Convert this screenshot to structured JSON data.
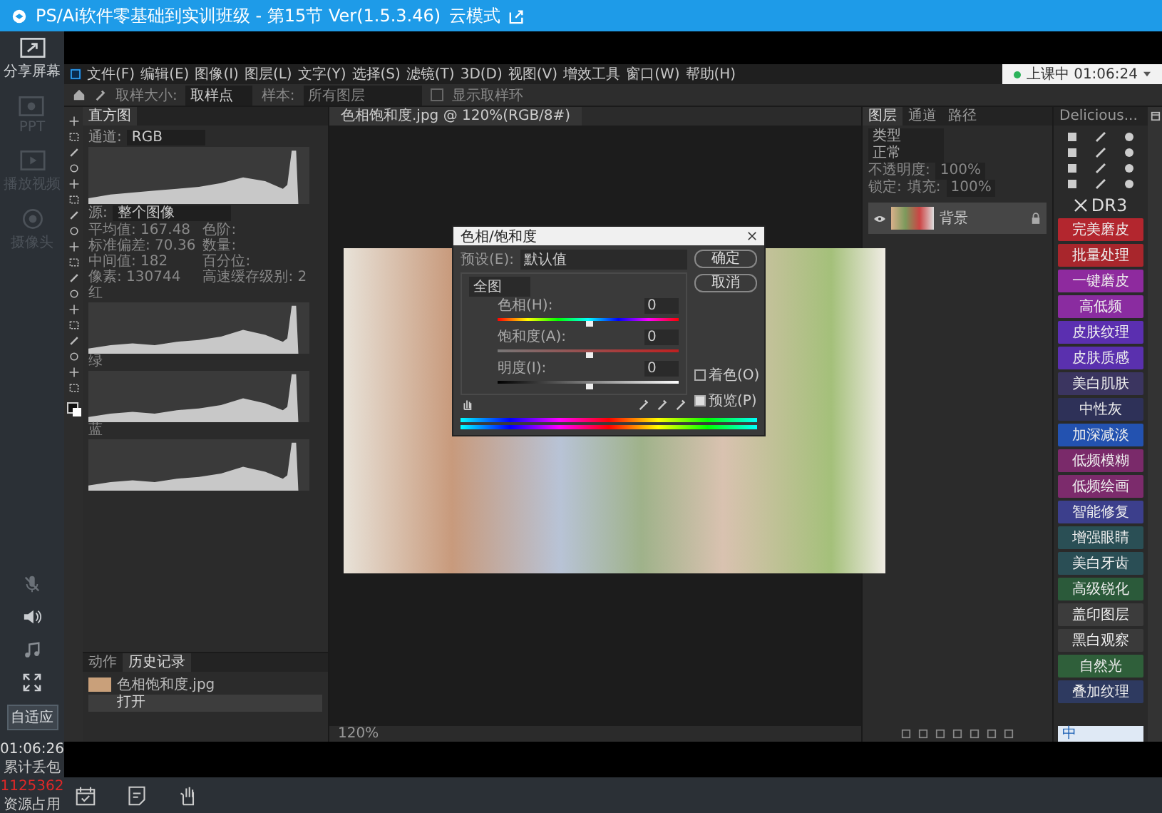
{
  "title_bar": {
    "title": "PS/Ai软件零基础到实训班级 - 第15节 Ver(1.5.3.46)",
    "mode": "云模式"
  },
  "sidebar": {
    "items": [
      {
        "label": "分享屏幕",
        "kind": "share",
        "disabled": false
      },
      {
        "label": "PPT",
        "kind": "ppt",
        "disabled": true
      },
      {
        "label": "播放视频",
        "kind": "video",
        "disabled": true
      },
      {
        "label": "摄像头",
        "kind": "camera",
        "disabled": true
      }
    ],
    "mic_muted": true,
    "fit_button": "自适应",
    "timer": "01:06:26",
    "loss_label": "累计丢包",
    "loss_value": "1125362",
    "resource_label": "资源占用"
  },
  "live_status": {
    "label": "上课中 01:06:24",
    "live": true
  },
  "photoshop": {
    "menu": [
      "文件(F)",
      "编辑(E)",
      "图像(I)",
      "图层(L)",
      "文字(Y)",
      "选择(S)",
      "滤镜(T)",
      "3D(D)",
      "视图(V)",
      "增效工具",
      "窗口(W)",
      "帮助(H)"
    ],
    "options": {
      "sample_size_label": "取样大小:",
      "sample_size": "取样点",
      "sample_label": "样本:",
      "sample": "所有图层",
      "ring_label": "显示取样环",
      "ring_checked": false
    },
    "histogram": {
      "tab": "直方图",
      "channel_label": "通道:",
      "channel": "RGB",
      "source_label": "源:",
      "source": "整个图像",
      "stats": [
        {
          "label": "平均值:",
          "value": "167.48"
        },
        {
          "label": "标准偏差:",
          "value": "70.36"
        },
        {
          "label": "中间值:",
          "value": "182"
        },
        {
          "label": "像素:",
          "value": "130744"
        }
      ],
      "stats_right": [
        {
          "label": "色阶:"
        },
        {
          "label": "数量:"
        },
        {
          "label": "百分位:"
        },
        {
          "label": "高速缓存级别:",
          "value": "2"
        }
      ],
      "channels": [
        "红",
        "绿",
        "蓝"
      ]
    },
    "history": {
      "tabs": [
        {
          "label": "动作",
          "selected": false
        },
        {
          "label": "历史记录",
          "selected": true
        }
      ],
      "snapshot": "色相饱和度.jpg",
      "steps": [
        {
          "label": "打开",
          "selected": true
        }
      ]
    },
    "document": {
      "tab": "色相饱和度.jpg @ 120%(RGB/8#)",
      "zoom": "120%"
    },
    "dialog": {
      "title": "色相/饱和度",
      "preset_label": "预设(E):",
      "preset": "默认值",
      "range": "全图",
      "sliders": [
        {
          "label": "色相(H):",
          "value": "0",
          "level": 0.5,
          "kind": "hue"
        },
        {
          "label": "饱和度(A):",
          "value": "0",
          "level": 0.5,
          "kind": "saturation"
        },
        {
          "label": "明度(I):",
          "value": "0",
          "level": 0.5,
          "kind": "lightness"
        }
      ],
      "ok": "确定",
      "cancel": "取消",
      "colorize": {
        "label": "着色(O)",
        "checked": false
      },
      "preview": {
        "label": "预览(P)",
        "checked": true
      }
    },
    "layers": {
      "tabs": [
        {
          "label": "图层",
          "selected": true
        },
        {
          "label": "通道",
          "selected": false
        },
        {
          "label": "路径",
          "selected": false
        }
      ],
      "filter": "类型",
      "blend": "正常",
      "opacity_label": "不透明度:",
      "opacity": "100%",
      "lock_label": "锁定:",
      "fill_label": "填充:",
      "fill": "100%",
      "items": [
        {
          "name": "背景",
          "visible": true,
          "locked": true
        }
      ]
    },
    "dr3": {
      "tab": "Delicious...",
      "logo": "DR3",
      "buttons": [
        {
          "label": "完美磨皮",
          "color": "#b3262e"
        },
        {
          "label": "批量处理",
          "color": "#a8262c"
        },
        {
          "label": "一键磨皮",
          "color": "#8e2a9e"
        },
        {
          "label": "高低频",
          "color": "#8a2ca0"
        },
        {
          "label": "皮肤纹理",
          "color": "#5b2fb0"
        },
        {
          "label": "皮肤质感",
          "color": "#5a30ae"
        },
        {
          "label": "美白肌肤",
          "color": "#3b3560"
        },
        {
          "label": "中性灰",
          "color": "#2e3158"
        },
        {
          "label": "加深减淡",
          "color": "#2352b0"
        },
        {
          "label": "低频模糊",
          "color": "#7a2a6a"
        },
        {
          "label": "低频绘画",
          "color": "#7c2b6c"
        },
        {
          "label": "智能修复",
          "color": "#3c3f8c"
        },
        {
          "label": "增强眼睛",
          "color": "#2a4f55"
        },
        {
          "label": "美白牙齿",
          "color": "#2a4e55"
        },
        {
          "label": "高级锐化",
          "color": "#2b5a3a"
        },
        {
          "label": "盖印图层",
          "color": "#3c3c3c"
        },
        {
          "label": "黑白观察",
          "color": "#3a3a3a"
        },
        {
          "label": "自然光",
          "color": "#2f5f3a"
        },
        {
          "label": "叠加纹理",
          "color": "#2e3a60"
        }
      ]
    },
    "ime": "中"
  }
}
